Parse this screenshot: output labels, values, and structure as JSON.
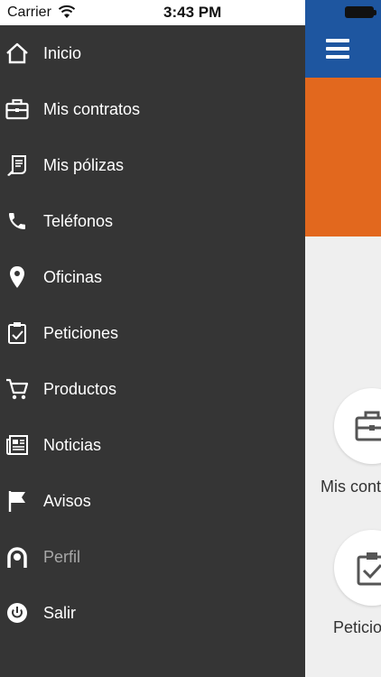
{
  "status_bar": {
    "carrier": "Carrier",
    "time": "3:43 PM"
  },
  "colors": {
    "drawer_bg": "#353535",
    "top_bar_blue": "#1e56a0",
    "banner_orange": "#e2681e",
    "content_bg": "#efefef"
  },
  "menu": {
    "items": [
      {
        "label": "Inicio",
        "icon": "home-icon"
      },
      {
        "label": "Mis contratos",
        "icon": "briefcase-icon"
      },
      {
        "label": "Mis pólizas",
        "icon": "policy-document-icon"
      },
      {
        "label": "Teléfonos",
        "icon": "phone-icon"
      },
      {
        "label": "Oficinas",
        "icon": "location-pin-icon"
      },
      {
        "label": "Peticiones",
        "icon": "clipboard-check-icon"
      },
      {
        "label": "Productos",
        "icon": "cart-icon"
      },
      {
        "label": "Noticias",
        "icon": "newspaper-icon"
      },
      {
        "label": "Avisos",
        "icon": "flag-icon"
      },
      {
        "label": "Perfil",
        "icon": "profile-icon"
      },
      {
        "label": "Salir",
        "icon": "power-icon"
      }
    ]
  },
  "background_page": {
    "hamburger_icon": "menu-icon",
    "tiles": [
      {
        "label": "Mis contratos",
        "icon": "briefcase-icon"
      },
      {
        "label": "Peticiones",
        "icon": "clipboard-check-icon"
      }
    ]
  }
}
